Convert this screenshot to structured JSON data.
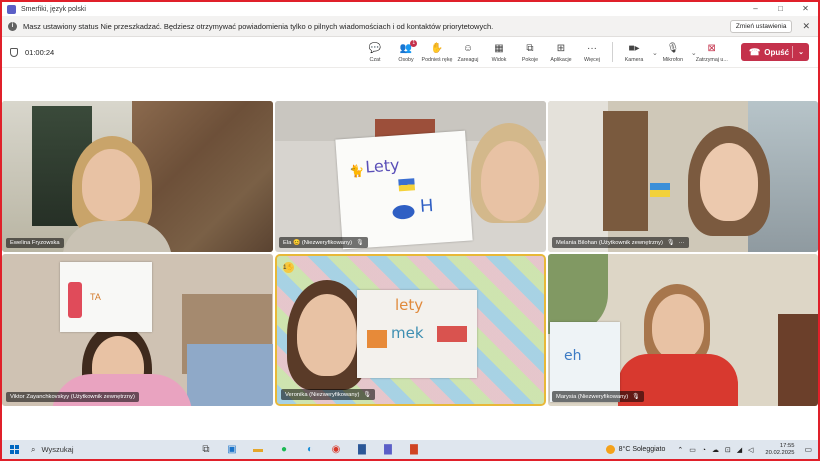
{
  "window": {
    "title": "Smerfiki, język polski",
    "controls": [
      "–",
      "□",
      "✕"
    ]
  },
  "notice": {
    "message": "Masz ustawiony status Nie przeszkadzać. Będziesz otrzymywać powiadomienia tylko o pilnych wiadomościach i od kontaktów priorytetowych.",
    "button": "Zmień ustawienia",
    "close": "✕"
  },
  "toolbar": {
    "timer": "01:00:24",
    "tools": [
      {
        "label": "Czat",
        "icon": "💬"
      },
      {
        "label": "Osoby",
        "icon": "👥",
        "badge": "1"
      },
      {
        "label": "Podnieś rękę",
        "icon": "✋"
      },
      {
        "label": "Zareaguj",
        "icon": "☺"
      },
      {
        "label": "Widok",
        "icon": "▦"
      },
      {
        "label": "Pokoje",
        "icon": "⧉"
      },
      {
        "label": "Aplikacje",
        "icon": "⊞"
      },
      {
        "label": "Więcej",
        "icon": "···"
      }
    ],
    "camera_label": "Kamera",
    "mic_label": "Mikrofon",
    "stop_share_label": "Zatrzymaj u...",
    "leave_label": "Opuść"
  },
  "participants": [
    {
      "name": "Ewelina Fryzowska",
      "mic": "",
      "more": ""
    },
    {
      "name": "Ela 😊 (Niezweryfikowany)",
      "mic": "🎙",
      "more": ""
    },
    {
      "name": "Melania Bilohan (Użytkownik zewnętrzny)",
      "mic": "🎙",
      "more": "···"
    },
    {
      "name": "Viktor Zayanchkovskyy (Użytkownik zewnętrzny)",
      "mic": "",
      "more": ""
    },
    {
      "name": "Veronika (Niezweryfikowany)",
      "mic": "🎙",
      "more": ""
    },
    {
      "name": "Marysia (Niezweryfikowany)",
      "mic": "🎙",
      "more": ""
    }
  ],
  "drawings": {
    "ela": "Lety",
    "veronika_1": "lety",
    "veronika_2": "mek",
    "marysia": "eh"
  },
  "taskbar": {
    "search_placeholder": "Wyszukaj",
    "weather": "8°C  Soleggiato",
    "time": "17:55",
    "date": "20.02.2025"
  },
  "colors": {
    "accent": "#5b5fc7",
    "leave": "#c4314b",
    "active_border": "#e8b838",
    "badge": "#c4314b"
  }
}
